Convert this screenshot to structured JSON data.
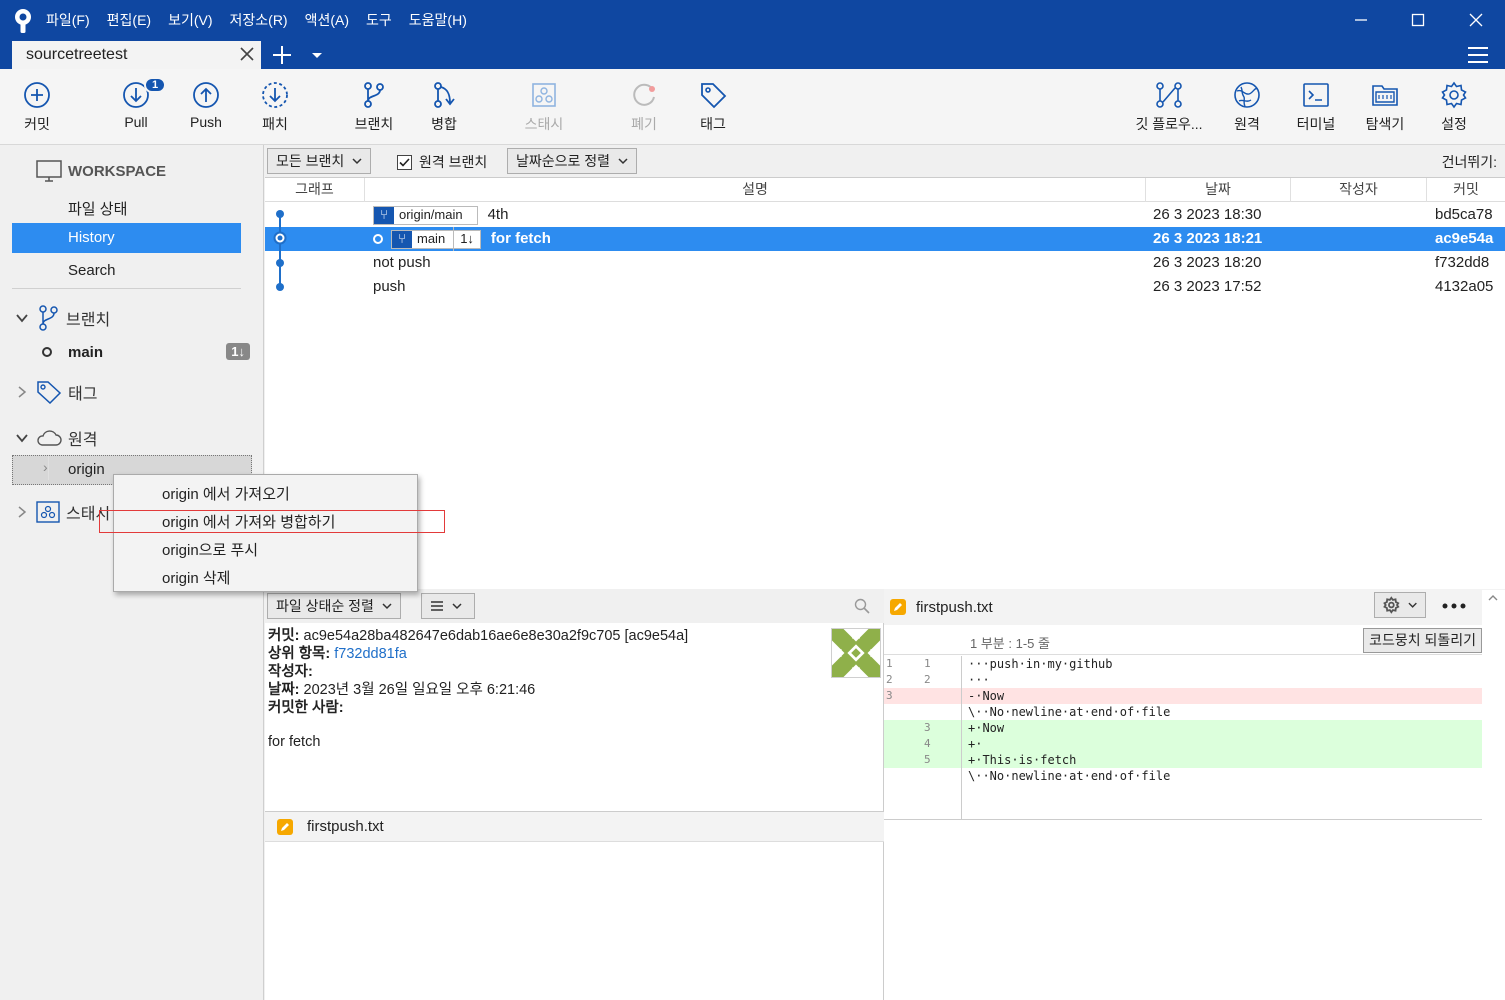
{
  "menu": [
    "파일(F)",
    "편집(E)",
    "보기(V)",
    "저장소(R)",
    "액션(A)",
    "도구",
    "도움말(H)"
  ],
  "tab": {
    "title": "sourcetreetest"
  },
  "toolbar": {
    "commit": "커밋",
    "pull": "Pull",
    "pull_badge": "1",
    "push": "Push",
    "patch": "패치",
    "branch": "브랜치",
    "merge": "병합",
    "stash": "스태시",
    "discard": "폐기",
    "tag": "태그",
    "gitflow": "깃 플로우...",
    "remote": "원격",
    "terminal": "터미널",
    "explorer": "탐색기",
    "settings": "설정"
  },
  "sidebar": {
    "workspace": "WORKSPACE",
    "items": [
      "파일 상태",
      "History",
      "Search"
    ],
    "branches": "브랜치",
    "main_branch": "main",
    "main_count": "1↓",
    "tags": "태그",
    "remotes": "원격",
    "origin": "origin",
    "stash": "스태시"
  },
  "context_menu": [
    "origin 에서 가져오기",
    "origin 에서 가져와 병합하기",
    "origin으로 푸시",
    "origin 삭제"
  ],
  "filter": {
    "branches": "모든 브랜치",
    "remote_branches": "원격 브랜치",
    "sort": "날짜순으로 정렬",
    "skip": "건너뛰기:"
  },
  "columns": {
    "graph": "그래프",
    "desc": "설명",
    "date": "날짜",
    "author": "작성자",
    "commit": "커밋"
  },
  "commits": [
    {
      "ref": "origin/main",
      "ref_count": "",
      "desc": "4th",
      "date": "26 3 2023 18:30",
      "hash": "bd5ca78"
    },
    {
      "ref": "main",
      "ref_count": "1↓",
      "desc": "for fetch",
      "date": "26 3 2023 18:21",
      "hash": "ac9e54a"
    },
    {
      "ref": "",
      "ref_count": "",
      "desc": "not push",
      "date": "26 3 2023 18:20",
      "hash": "f732dd8"
    },
    {
      "ref": "",
      "ref_count": "",
      "desc": "push",
      "date": "26 3 2023 17:52",
      "hash": "4132a05"
    }
  ],
  "detail": {
    "sort": "파일 상태순 정렬",
    "commit_label": "커밋:",
    "commit_value": "ac9e54a28ba482647e6dab16ae6e8e30a2f9c705 [ac9e54a]",
    "parent_label": "상위 항목:",
    "parent_value": "f732dd81fa",
    "author_label": "작성자:",
    "date_label": "날짜:",
    "date_value": "2023년 3월 26일 일요일 오후 6:21:46",
    "committer_label": "커밋한 사람:",
    "message": "for fetch",
    "file": "firstpush.txt"
  },
  "diff": {
    "file": "firstpush.txt",
    "hunk": "1 부분 : 1-5 줄",
    "discard_hunk": "코드뭉치 되돌리기",
    "lines": [
      {
        "n1": "1",
        "n2": "1",
        "text": "···push·in·my·github",
        "type": "ctx"
      },
      {
        "n1": "2",
        "n2": "2",
        "text": "···",
        "type": "ctx"
      },
      {
        "n1": "3",
        "n2": "",
        "text": "-·Now",
        "type": "del"
      },
      {
        "n1": "",
        "n2": "",
        "text": "\\··No·newline·at·end·of·file",
        "type": "ctx"
      },
      {
        "n1": "",
        "n2": "3",
        "text": "+·Now",
        "type": "add"
      },
      {
        "n1": "",
        "n2": "4",
        "text": "+·",
        "type": "add"
      },
      {
        "n1": "",
        "n2": "5",
        "text": "+·This·is·fetch",
        "type": "add"
      },
      {
        "n1": "",
        "n2": "",
        "text": "\\··No·newline·at·end·of·file",
        "type": "ctx"
      }
    ]
  }
}
